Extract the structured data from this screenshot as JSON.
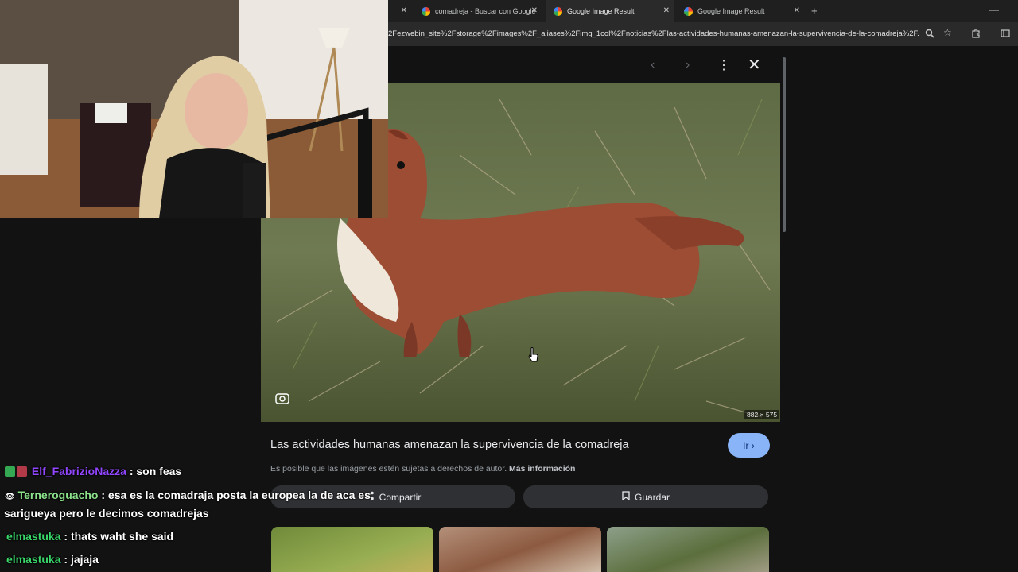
{
  "browser": {
    "tabs": [
      {
        "label": "",
        "active": false
      },
      {
        "label": "comadreja - Buscar con Google",
        "active": false
      },
      {
        "label": "Google Image Result",
        "active": true
      },
      {
        "label": "Google Image Result",
        "active": false
      }
    ],
    "new_tab_symbol": "+",
    "minimize_symbol": "—",
    "url": "2Fezwebin_site%2Fstorage%2Fimages%2F_aliases%2Fimg_1col%2Fnoticias%2Flas-actividades-humanas-amenazan-la-supervivencia-de-la-comadreja%2F..."
  },
  "viewer": {
    "image_dimensions": "882 × 575",
    "title": "Las actividades humanas amenazan la supervivencia de la comadreja",
    "visit_label": "Ir",
    "copyright_text": "Es posible que las imágenes estén sujetas a derechos de autor.",
    "more_info_label": "Más información",
    "share_label": "Compartir",
    "save_label": "Guardar"
  },
  "chat": {
    "messages": [
      {
        "user": "Elf_FabrizioNazza",
        "user_color": "#9146ff",
        "text": "son feas"
      },
      {
        "user": "Terneroguacho",
        "user_color": "#7fe37f",
        "text": "esa es la comadraja posta la europea la de aca es"
      },
      {
        "user": "",
        "user_color": "#ffffff",
        "text": "sarigueya pero le decimos comadrejas"
      },
      {
        "user": "elmastuka",
        "user_color": "#3ad86a",
        "text": "thats waht she said"
      },
      {
        "user": "elmastuka",
        "user_color": "#3ad86a",
        "text": "jajaja"
      }
    ]
  },
  "colors": {
    "page_bg": "#121212",
    "accent_button": "#8ab4f8"
  }
}
